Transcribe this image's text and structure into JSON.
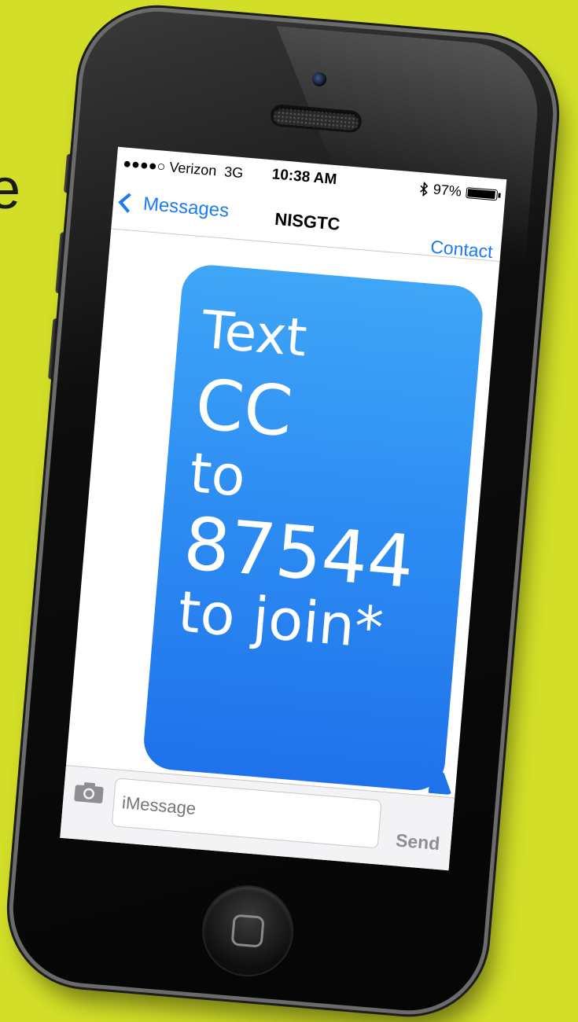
{
  "background_text": "e",
  "status_bar": {
    "carrier": "●●●●○ Verizon",
    "network": "3G",
    "time": "10:38 AM",
    "bluetooth_icon": "bluetooth-icon",
    "battery_percent": "97%",
    "battery_level": 0.97
  },
  "nav": {
    "back_label": "Messages",
    "title": "NISGTC",
    "contact_label": "Contact"
  },
  "message": {
    "line1": "Text",
    "line2": "CC",
    "line3": "to",
    "line4": "87544",
    "line5": "to join*"
  },
  "composer": {
    "placeholder": "iMessage",
    "send_label": "Send"
  },
  "colors": {
    "background": "#d2de27",
    "accent": "#1a7cf0",
    "bubble": "#2e8ef3"
  }
}
